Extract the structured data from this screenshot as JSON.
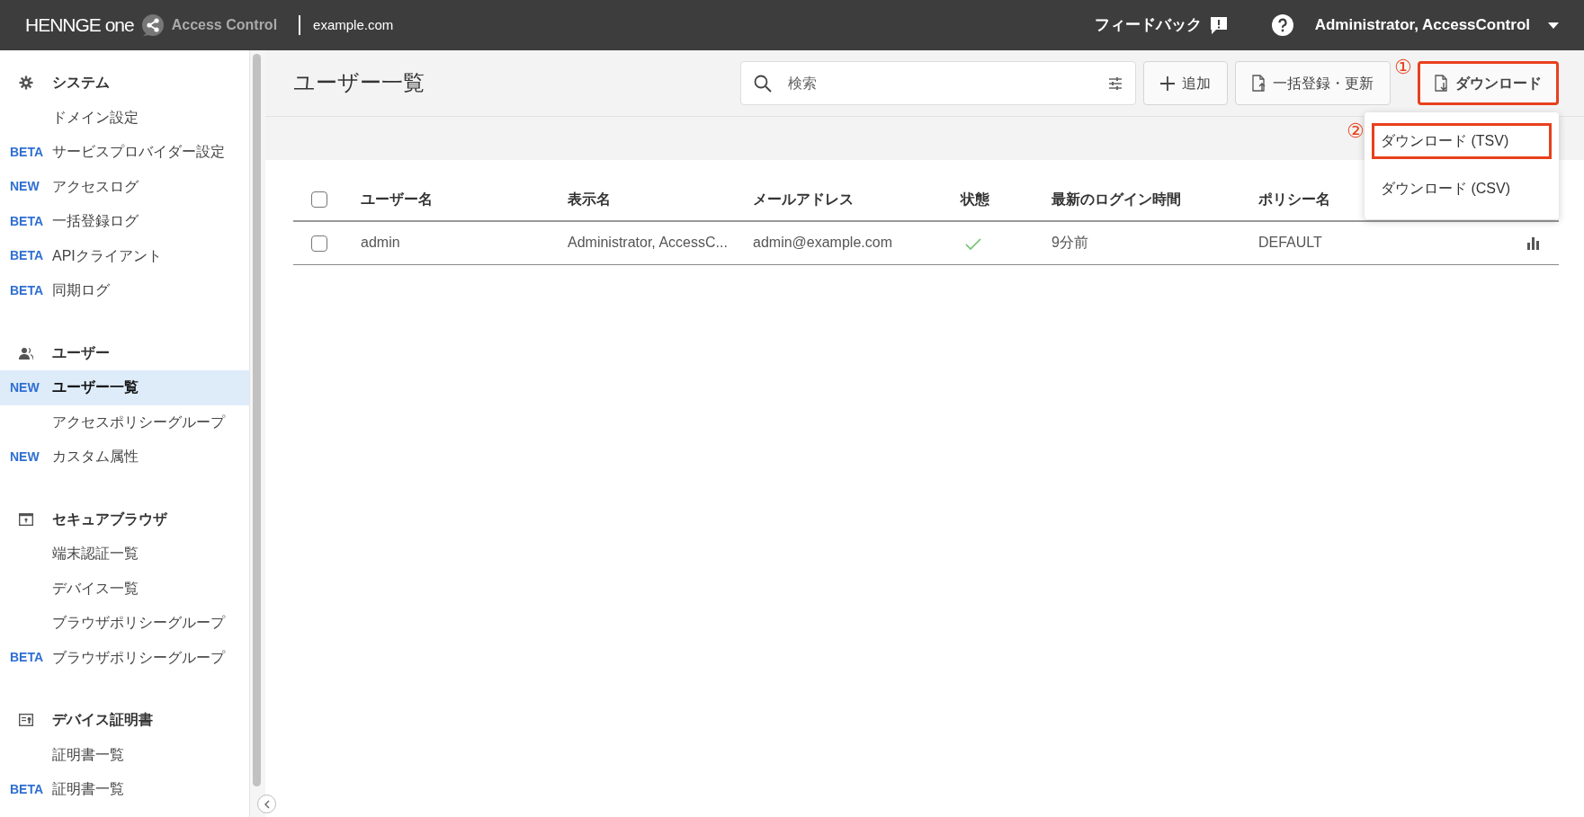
{
  "topbar": {
    "brand": "HENNGE one",
    "product": "Access Control",
    "domain": "example.com",
    "feedback": "フィードバック",
    "user": "Administrator, AccessControl"
  },
  "sidebar": {
    "sections": [
      {
        "title": "システム",
        "items": [
          {
            "label": "ドメイン設定",
            "selected": false
          },
          {
            "badge": "BETA",
            "label": "サービスプロバイダー設定",
            "selected": false
          },
          {
            "badge": "NEW",
            "label": "アクセスログ",
            "selected": false
          },
          {
            "badge": "BETA",
            "label": "一括登録ログ",
            "selected": false
          },
          {
            "badge": "BETA",
            "label": "APIクライアント",
            "selected": false
          },
          {
            "badge": "BETA",
            "label": "同期ログ",
            "selected": false
          }
        ]
      },
      {
        "title": "ユーザー",
        "items": [
          {
            "badge": "NEW",
            "label": "ユーザー一覧",
            "selected": true
          },
          {
            "label": "アクセスポリシーグループ",
            "selected": false
          },
          {
            "badge": "NEW",
            "label": "カスタム属性",
            "selected": false
          }
        ]
      },
      {
        "title": "セキュアブラウザ",
        "items": [
          {
            "label": "端末認証一覧",
            "selected": false
          },
          {
            "label": "デバイス一覧",
            "selected": false
          },
          {
            "label": "ブラウザポリシーグループ",
            "selected": false
          },
          {
            "badge": "BETA",
            "label": "ブラウザポリシーグループ",
            "selected": false
          }
        ]
      },
      {
        "title": "デバイス証明書",
        "items": [
          {
            "label": "証明書一覧",
            "selected": false
          },
          {
            "badge": "BETA",
            "label": "証明書一覧",
            "selected": false
          }
        ]
      }
    ]
  },
  "page": {
    "title": "ユーザー一覧",
    "search": {
      "placeholder": "検索"
    },
    "buttons": [
      {
        "kind": "add",
        "label": "追加",
        "highlighted": false
      },
      {
        "kind": "upload",
        "label": "一括登録・更新",
        "highlighted": false
      },
      {
        "kind": "download",
        "label": "ダウンロード",
        "highlighted": true,
        "annotation": "①"
      }
    ],
    "menu": [
      {
        "label": "ダウンロード (TSV)",
        "highlighted": true,
        "annotation": "②"
      },
      {
        "label": "ダウンロード (CSV)",
        "highlighted": false
      }
    ]
  },
  "table": {
    "select_all": {
      "checked": false
    },
    "columns": [
      "ユーザー名",
      "表示名",
      "メールアドレス",
      "状態",
      "最新のログイン時間",
      "ポリシー名"
    ],
    "rows": [
      {
        "checked": false,
        "username": "admin",
        "display_name": "Administrator, AccessC...",
        "email": "admin@example.com",
        "active": true,
        "last_login": "9分前",
        "policy": "DEFAULT"
      }
    ]
  }
}
